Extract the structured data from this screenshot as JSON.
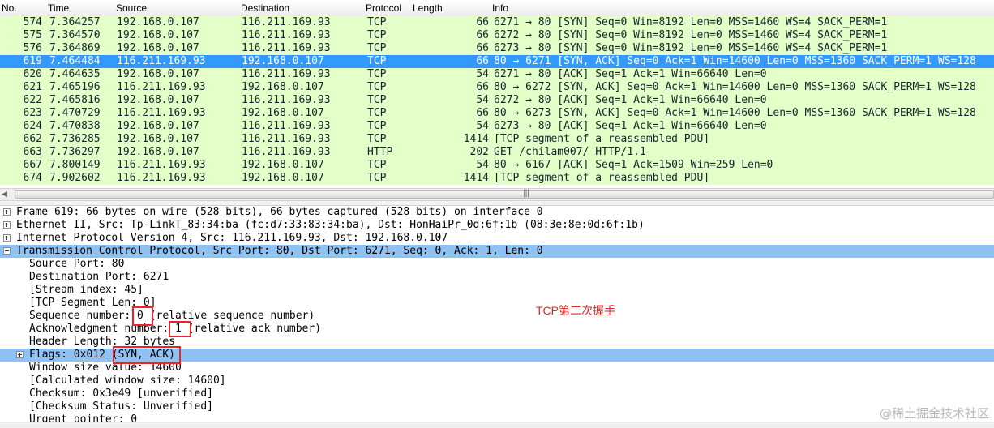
{
  "columns": {
    "no": "No.",
    "time": "Time",
    "source": "Source",
    "destination": "Destination",
    "protocol": "Protocol",
    "length": "Length",
    "info": "Info"
  },
  "colors": {
    "row_tcp_http": "#e4ffc7",
    "row_selected": "#3399ff",
    "row_selected_text": "#ffffff",
    "detail_selected": "#8fc1f2",
    "annotation": "#e8262a"
  },
  "packets": [
    {
      "no": "574",
      "time": "7.364257",
      "source": "192.168.0.107",
      "destination": "116.211.169.93",
      "protocol": "TCP",
      "length": "66",
      "info": "6271 → 80 [SYN] Seq=0 Win=8192 Len=0 MSS=1460 WS=4 SACK_PERM=1",
      "selected": false
    },
    {
      "no": "575",
      "time": "7.364570",
      "source": "192.168.0.107",
      "destination": "116.211.169.93",
      "protocol": "TCP",
      "length": "66",
      "info": "6272 → 80 [SYN] Seq=0 Win=8192 Len=0 MSS=1460 WS=4 SACK_PERM=1",
      "selected": false
    },
    {
      "no": "576",
      "time": "7.364869",
      "source": "192.168.0.107",
      "destination": "116.211.169.93",
      "protocol": "TCP",
      "length": "66",
      "info": "6273 → 80 [SYN] Seq=0 Win=8192 Len=0 MSS=1460 WS=4 SACK_PERM=1",
      "selected": false
    },
    {
      "no": "619",
      "time": "7.464484",
      "source": "116.211.169.93",
      "destination": "192.168.0.107",
      "protocol": "TCP",
      "length": "66",
      "info": "80 → 6271 [SYN, ACK] Seq=0 Ack=1 Win=14600 Len=0 MSS=1360 SACK_PERM=1 WS=128",
      "selected": true
    },
    {
      "no": "620",
      "time": "7.464635",
      "source": "192.168.0.107",
      "destination": "116.211.169.93",
      "protocol": "TCP",
      "length": "54",
      "info": "6271 → 80 [ACK] Seq=1 Ack=1 Win=66640 Len=0",
      "selected": false
    },
    {
      "no": "621",
      "time": "7.465196",
      "source": "116.211.169.93",
      "destination": "192.168.0.107",
      "protocol": "TCP",
      "length": "66",
      "info": "80 → 6272 [SYN, ACK] Seq=0 Ack=1 Win=14600 Len=0 MSS=1360 SACK_PERM=1 WS=128",
      "selected": false
    },
    {
      "no": "622",
      "time": "7.465816",
      "source": "192.168.0.107",
      "destination": "116.211.169.93",
      "protocol": "TCP",
      "length": "54",
      "info": "6272 → 80 [ACK] Seq=1 Ack=1 Win=66640 Len=0",
      "selected": false
    },
    {
      "no": "623",
      "time": "7.470729",
      "source": "116.211.169.93",
      "destination": "192.168.0.107",
      "protocol": "TCP",
      "length": "66",
      "info": "80 → 6273 [SYN, ACK] Seq=0 Ack=1 Win=14600 Len=0 MSS=1360 SACK_PERM=1 WS=128",
      "selected": false
    },
    {
      "no": "624",
      "time": "7.470838",
      "source": "192.168.0.107",
      "destination": "116.211.169.93",
      "protocol": "TCP",
      "length": "54",
      "info": "6273 → 80 [ACK] Seq=1 Ack=1 Win=66640 Len=0",
      "selected": false
    },
    {
      "no": "662",
      "time": "7.736285",
      "source": "192.168.0.107",
      "destination": "116.211.169.93",
      "protocol": "TCP",
      "length": "1414",
      "info": "[TCP segment of a reassembled PDU]",
      "selected": false
    },
    {
      "no": "663",
      "time": "7.736297",
      "source": "192.168.0.107",
      "destination": "116.211.169.93",
      "protocol": "HTTP",
      "length": "202",
      "info": "GET /chilam007/ HTTP/1.1",
      "selected": false
    },
    {
      "no": "667",
      "time": "7.800149",
      "source": "116.211.169.93",
      "destination": "192.168.0.107",
      "protocol": "TCP",
      "length": "54",
      "info": "80 → 6167 [ACK] Seq=1 Ack=1509 Win=259 Len=0",
      "selected": false
    },
    {
      "no": "674",
      "time": "7.902602",
      "source": "116.211.169.93",
      "destination": "192.168.0.107",
      "protocol": "TCP",
      "length": "1414",
      "info": "[TCP segment of a reassembled PDU]",
      "selected": false
    }
  ],
  "details": [
    {
      "text": "Frame 619: 66 bytes on wire (528 bits), 66 bytes captured (528 bits) on interface 0",
      "level": 0,
      "expander": "plus",
      "selected": false
    },
    {
      "text": "Ethernet II, Src: Tp-LinkT_83:34:ba (fc:d7:33:83:34:ba), Dst: HonHaiPr_0d:6f:1b (08:3e:8e:0d:6f:1b)",
      "level": 0,
      "expander": "plus",
      "selected": false
    },
    {
      "text": "Internet Protocol Version 4, Src: 116.211.169.93, Dst: 192.168.0.107",
      "level": 0,
      "expander": "plus",
      "selected": false
    },
    {
      "text": "Transmission Control Protocol, Src Port: 80, Dst Port: 6271, Seq: 0, Ack: 1, Len: 0",
      "level": 0,
      "expander": "minus",
      "selected": true
    },
    {
      "text": "Source Port: 80",
      "level": 1,
      "expander": "none",
      "selected": false
    },
    {
      "text": "Destination Port: 6271",
      "level": 1,
      "expander": "none",
      "selected": false
    },
    {
      "text": "[Stream index: 45]",
      "level": 1,
      "expander": "none",
      "selected": false
    },
    {
      "text": "[TCP Segment Len: 0]",
      "level": 1,
      "expander": "none",
      "selected": false
    },
    {
      "text": "Sequence number: 0    (relative sequence number)",
      "level": 1,
      "expander": "none",
      "selected": false
    },
    {
      "text": "Acknowledgment number: 1    (relative ack number)",
      "level": 1,
      "expander": "none",
      "selected": false
    },
    {
      "text": "Header Length: 32 bytes",
      "level": 1,
      "expander": "none",
      "selected": false
    },
    {
      "text": "Flags: 0x012 (SYN, ACK)",
      "level": 1,
      "expander": "plus",
      "selected": true
    },
    {
      "text": "Window size value: 14600",
      "level": 1,
      "expander": "none",
      "selected": false
    },
    {
      "text": "[Calculated window size: 14600]",
      "level": 1,
      "expander": "none",
      "selected": false
    },
    {
      "text": "Checksum: 0x3e49 [unverified]",
      "level": 1,
      "expander": "none",
      "selected": false
    },
    {
      "text": "[Checksum Status: Unverified]",
      "level": 1,
      "expander": "none",
      "selected": false
    },
    {
      "text": "Urgent pointer: 0",
      "level": 1,
      "expander": "none",
      "selected": false
    }
  ],
  "annotation": {
    "text": "TCP第二次握手"
  },
  "watermark": {
    "text": "@稀土掘金技术社区"
  }
}
